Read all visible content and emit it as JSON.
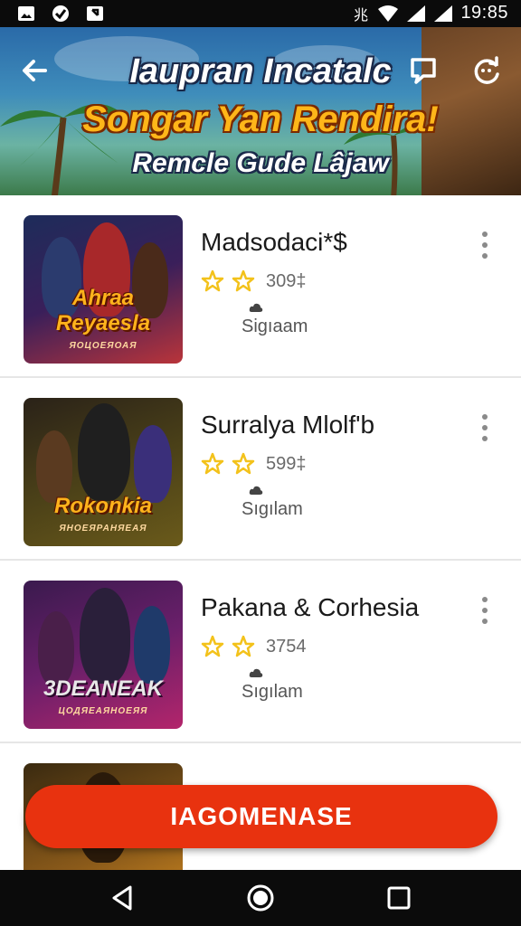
{
  "status_bar": {
    "time": "19:85",
    "left_icons": [
      "gallery-icon",
      "check-shield-icon",
      "download-icon"
    ],
    "right_icons": [
      "nfc-icon",
      "wifi-icon",
      "signal-icon",
      "signal-icon"
    ]
  },
  "header": {
    "title_line1": "Iaupran Incatalc",
    "title_line2": "Songar Yan Rendira!",
    "title_line3": "Remcle Gude Lâjaw",
    "back_icon": "back-arrow-icon",
    "chat_icon": "chat-icon",
    "refresh_icon": "refresh-icon"
  },
  "items": [
    {
      "title": "Madsodaci*$",
      "rating_count": "309‡",
      "developer": "Sigıaam",
      "art_title": "Ahraa Reyaesla",
      "art_sub": "ЯОЦОЕЯОАЯ",
      "stars": 2,
      "palette": [
        "#1d2c5a",
        "#b9343a",
        "#f4a11c"
      ]
    },
    {
      "title": "Surralya Mlolf'b",
      "rating_count": "599‡",
      "developer": "Sıgılam",
      "art_title": "Rokonkia",
      "art_sub": "ЯНОЕЯРАНЯЕАЯ",
      "stars": 2,
      "palette": [
        "#2a2218",
        "#6a5a1a",
        "#e2a21a"
      ]
    },
    {
      "title": "Pakana & Corhesia",
      "rating_count": "3754",
      "developer": "Sıgılam",
      "art_title": "3DEANEAK",
      "art_sub": "ЦОДЯЕАЯНОЕЯЯ",
      "stars": 2,
      "palette": [
        "#3a1a4e",
        "#b3256b",
        "#f0a437"
      ]
    }
  ],
  "cta": {
    "label": "IAGOMENASE"
  },
  "nav": {
    "back_icon": "nav-back-icon",
    "home_icon": "nav-home-icon",
    "recents_icon": "nav-recents-icon"
  },
  "colors": {
    "accent": "#e8320f",
    "star": "#f3c21b"
  }
}
